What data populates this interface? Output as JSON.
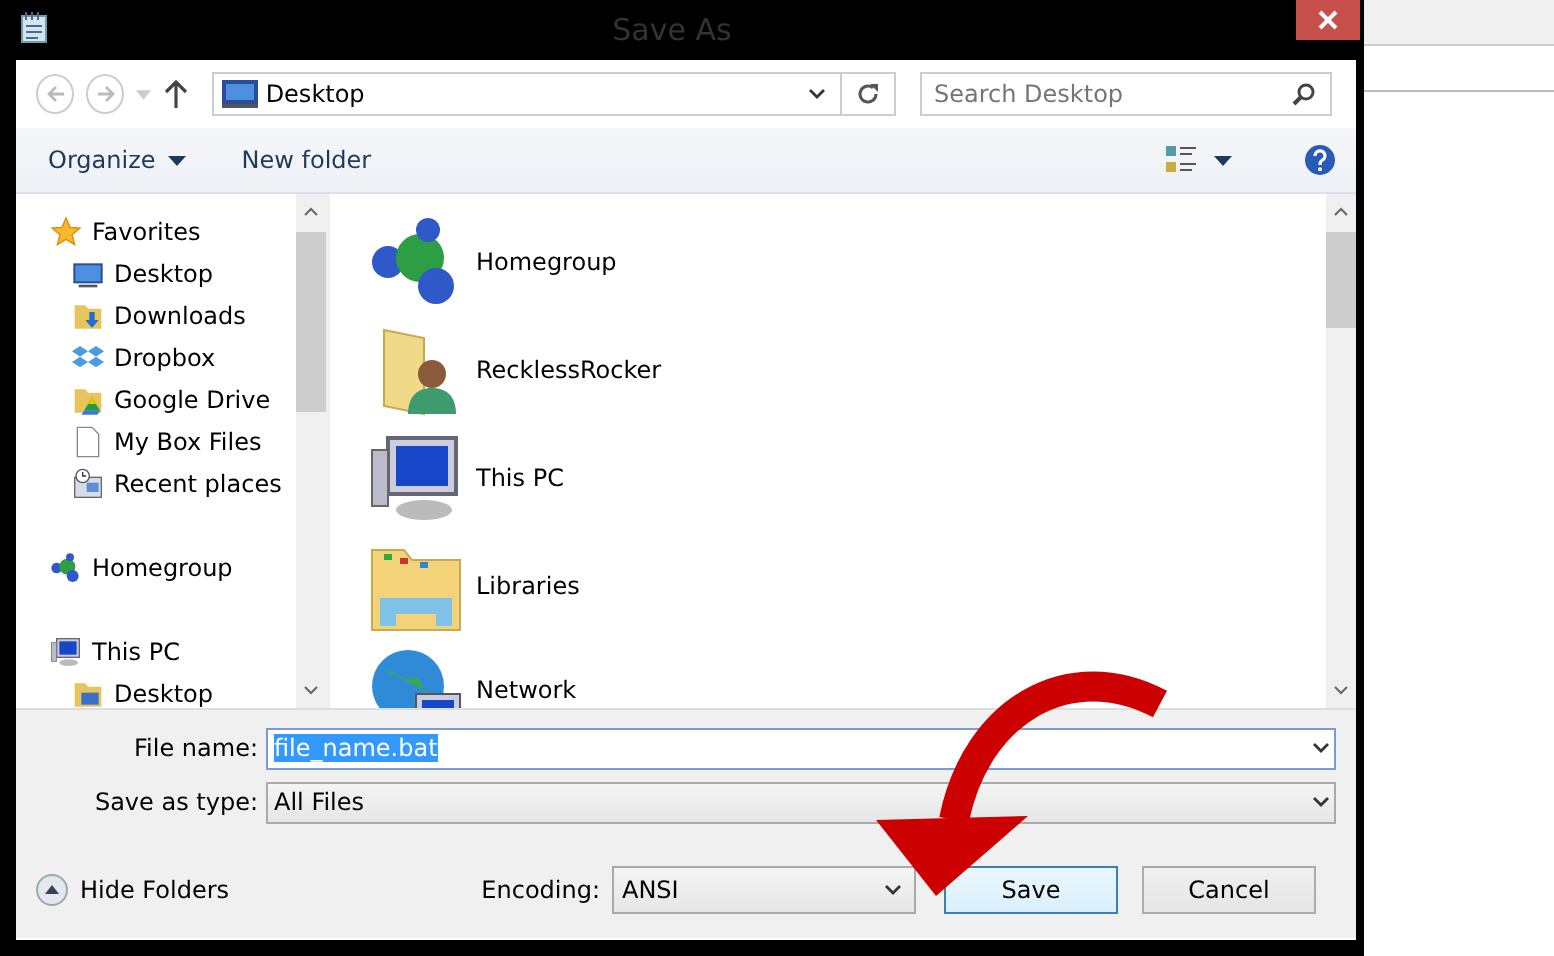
{
  "window": {
    "title": "Save As"
  },
  "address_bar": {
    "path": "Desktop",
    "search": {
      "placeholder": "Search Desktop"
    }
  },
  "toolbar": {
    "organize": "Organize",
    "new_folder": "New folder"
  },
  "navigation": [
    {
      "label": "Favorites",
      "kind": "star",
      "children": [
        {
          "label": "Desktop",
          "kind": "desktop"
        },
        {
          "label": "Downloads",
          "kind": "downloads"
        },
        {
          "label": "Dropbox",
          "kind": "dropbox"
        },
        {
          "label": "Google Drive",
          "kind": "drive"
        },
        {
          "label": "My Box Files",
          "kind": "file"
        },
        {
          "label": "Recent places",
          "kind": "recent"
        }
      ]
    },
    {
      "label": "Homegroup",
      "kind": "homegroup"
    },
    {
      "label": "This PC",
      "kind": "pc",
      "children": [
        {
          "label": "Desktop",
          "kind": "folder"
        }
      ]
    }
  ],
  "items": [
    {
      "label": "Homegroup",
      "kind": "homegroup"
    },
    {
      "label": "RecklessRocker",
      "kind": "user"
    },
    {
      "label": "This PC",
      "kind": "pc"
    },
    {
      "label": "Libraries",
      "kind": "libraries"
    },
    {
      "label": "Network",
      "kind": "network"
    }
  ],
  "form": {
    "file_name": {
      "label": "File name:",
      "value": "file_name.bat",
      "highlighted": true
    },
    "save_as_type": {
      "label": "Save as type:",
      "value": "All Files"
    }
  },
  "footer": {
    "hide_folders": "Hide Folders",
    "encoding": {
      "label": "Encoding:",
      "value": "ANSI"
    },
    "buttons": [
      {
        "label": "Save",
        "default": true
      },
      {
        "label": "Cancel",
        "default": false
      }
    ]
  }
}
